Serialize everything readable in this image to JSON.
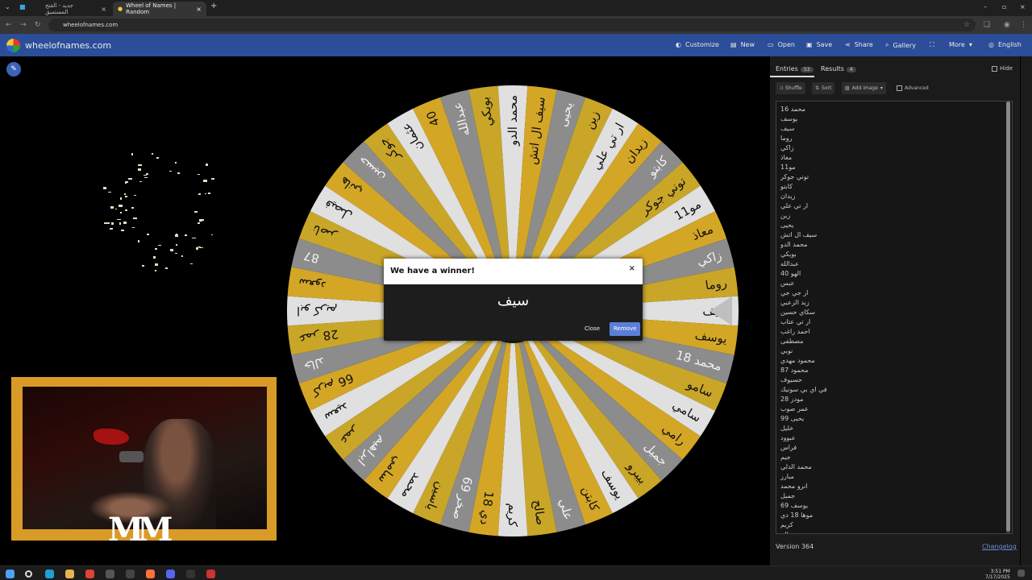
{
  "browser": {
    "tabs": [
      {
        "title": "جديد - الفتح المستميق"
      },
      {
        "title": "Wheel of Names | Random"
      }
    ],
    "url": "wheelofnames.com"
  },
  "app": {
    "brand": "wheelofnames.com",
    "menu": [
      "Customize",
      "New",
      "Open",
      "Save",
      "Share",
      "Gallery",
      "More",
      "English"
    ]
  },
  "panel": {
    "tabs": [
      {
        "label": "Entries",
        "count": "53"
      },
      {
        "label": "Results",
        "count": "4"
      }
    ],
    "hide_label": "Hide",
    "buttons": {
      "shuffle": "Shuffle",
      "sort": "Sort",
      "add_image": "Add image",
      "advanced": "Advanced"
    },
    "entries": [
      "محمد 16",
      "يوسف",
      "سيف",
      "روما",
      "زاكي",
      "معاذ",
      "مو11",
      "توني جوكر",
      "كابتو",
      "زيدان",
      "ار تي علي",
      "زين",
      "يحيى",
      "سيف ال اتش",
      "محمد الدو",
      "بويكي",
      "عبدالله",
      "الهو 40",
      "عبس",
      "ار جي جي",
      "زيد الزعبي",
      "سكاي حسين",
      "ار تي عتاب",
      "احمد راغب",
      "مصطفى",
      "نوبي",
      "محمود مهدي",
      "محمود 87",
      "حسيوف",
      "في اي بي سونيك",
      "مودز 28",
      "عمر صوب",
      "يحيى 99",
      "خليل",
      "عبوود",
      "فراس",
      "جيم",
      "محمد الدلي",
      "مبارز",
      "انرو محمد",
      "جميل",
      "يوسف 69",
      "موها 18 دي",
      "كريم",
      "صالح"
    ],
    "version": "Version 364",
    "changelog": "Changelog"
  },
  "dialog": {
    "title": "We have a winner!",
    "winner": "سيف",
    "close_label": "Close",
    "remove_label": "Remove",
    "close_x": "×"
  },
  "wheel": {
    "colors": [
      "#e0e0e0",
      "#d4a626",
      "#8c8c8c",
      "#c9a628"
    ],
    "labels": [
      "سيف",
      "يوسف",
      "محمد 18",
      "سامو",
      "سامي",
      "رامي",
      "جميل",
      "بيبرو",
      "يوسف",
      "كابتن",
      "علي",
      "صالح",
      "كريم",
      "دي 18",
      "69 صخر",
      "ياسين",
      "محمد",
      "سامي",
      "ابراهيم",
      "عمر",
      "سعيد",
      "66 كريم",
      "خالد",
      "28 عمر",
      "ابو كريم",
      "سعود",
      "87",
      "ناصر",
      "فيصل",
      "هاني",
      "حسين",
      "جوكر",
      "عثمان",
      "40",
      "عبدالله",
      "بويكي",
      "محمد الدو",
      "سيف ال اتش",
      "يحيى",
      "زين",
      "ار تي علي",
      "زيدان",
      "كابتو",
      "توني جوكر",
      "مو11",
      "معاذ",
      "زاكي",
      "روما"
    ]
  },
  "taskbar": {
    "time": "3:51 PM",
    "date": "7/17/2025"
  },
  "logo_text": "M"
}
